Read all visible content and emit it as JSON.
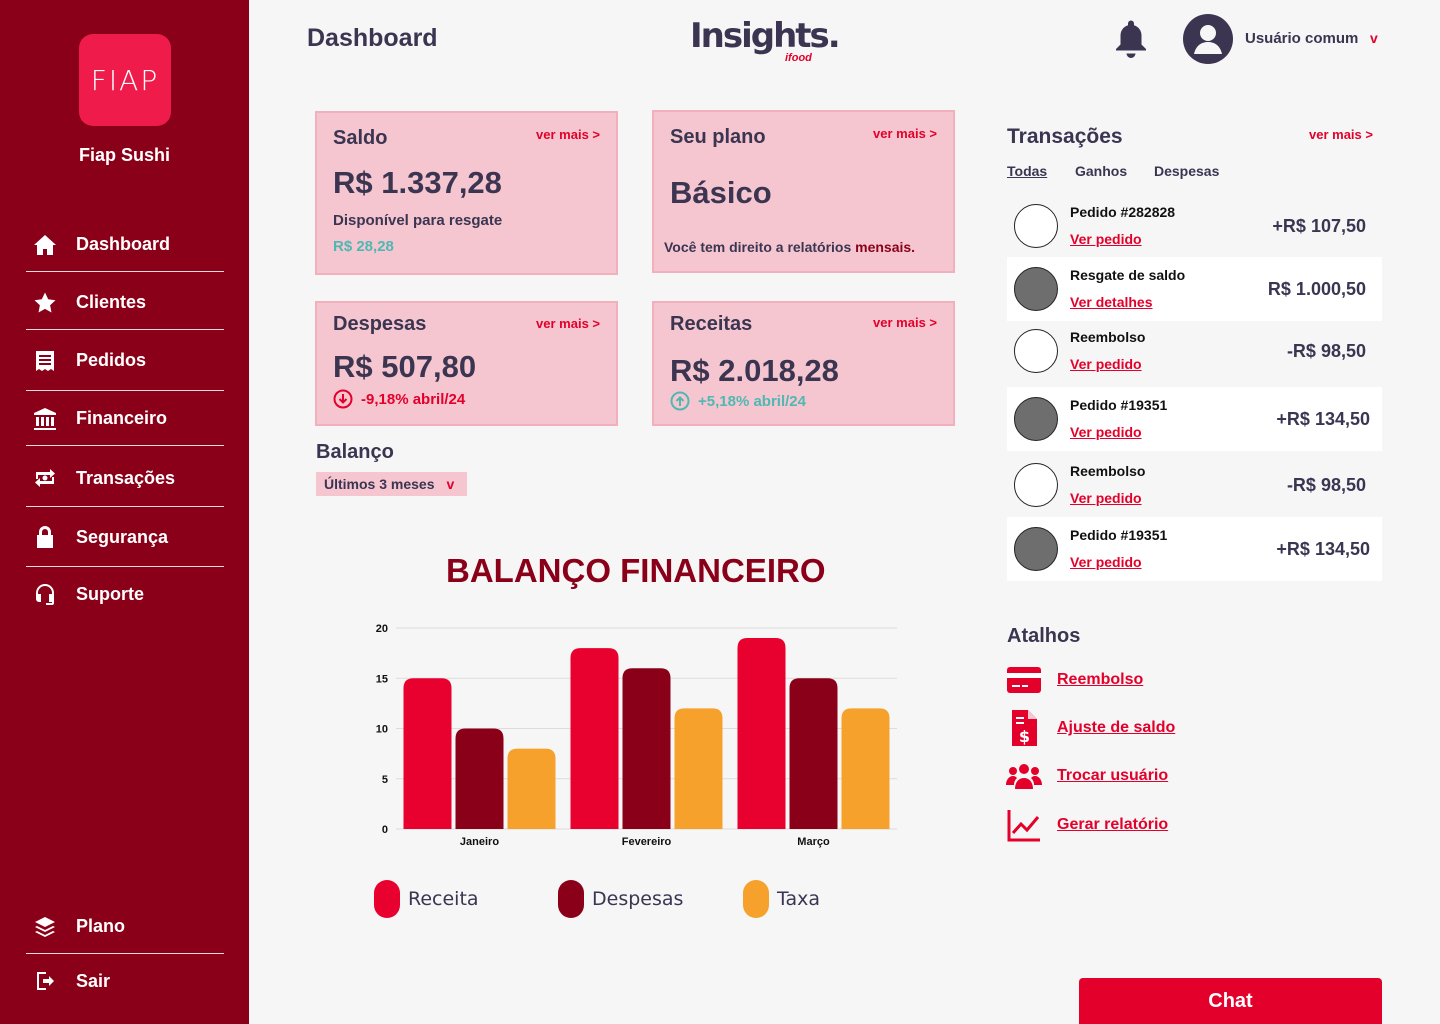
{
  "sidebar": {
    "logo_text": "FIAP",
    "brand": "Fiap Sushi",
    "items": [
      {
        "label": "Dashboard",
        "icon": "home-icon"
      },
      {
        "label": "Clientes",
        "icon": "star-icon"
      },
      {
        "label": "Pedidos",
        "icon": "receipt-icon"
      },
      {
        "label": "Financeiro",
        "icon": "bank-icon"
      },
      {
        "label": "Transações",
        "icon": "money-exchange-icon"
      },
      {
        "label": "Segurança",
        "icon": "lock-icon"
      },
      {
        "label": "Suporte",
        "icon": "headset-icon"
      }
    ],
    "bottom_items": [
      {
        "label": "Plano",
        "icon": "layers-icon"
      },
      {
        "label": "Sair",
        "icon": "logout-icon"
      }
    ]
  },
  "header": {
    "title": "Dashboard",
    "brand_logo": "Insights.",
    "brand_logo_sub": "ifood",
    "user_name": "Usuário comum",
    "user_chevron": "v"
  },
  "cards": {
    "ver_mais": "ver mais  >",
    "saldo": {
      "title": "Saldo",
      "value": "R$ 1.337,28",
      "sub": "Disponível para resgate",
      "sub_value": "R$ 28,28"
    },
    "plano": {
      "title": "Seu plano",
      "value": "Básico",
      "note_prefix": "Você tem direito a relatórios ",
      "note_highlight": "mensais."
    },
    "despesas": {
      "title": "Despesas",
      "value": "R$ 507,80",
      "trend": "-9,18% abril/24"
    },
    "receitas": {
      "title": "Receitas",
      "value": "R$ 2.018,28",
      "trend": "+5,18% abril/24"
    }
  },
  "balanco": {
    "title": "Balanço",
    "period": "Últimos 3 meses",
    "period_chevron": "v"
  },
  "chart_data": {
    "type": "bar",
    "title": "BALANÇO FINANCEIRO",
    "categories": [
      "Janeiro",
      "Fevereiro",
      "Março"
    ],
    "series": [
      {
        "name": "Receita",
        "values": [
          15,
          18,
          19
        ],
        "color": "#e8002f"
      },
      {
        "name": "Despesas",
        "values": [
          10,
          16,
          15
        ],
        "color": "#8a0019"
      },
      {
        "name": "Taxa",
        "values": [
          8,
          12,
          12
        ],
        "color": "#f5a12b"
      }
    ],
    "yticks": [
      0,
      5,
      10,
      15,
      20
    ],
    "ylim": [
      0,
      20
    ],
    "grid": true,
    "legend": "bottom"
  },
  "transactions": {
    "title": "Transações",
    "ver_mais": "ver mais  >",
    "tabs": [
      "Todas",
      "Ganhos",
      "Despesas"
    ],
    "rows": [
      {
        "name": "Pedido #282828",
        "link": "Ver pedido",
        "amount": "+R$ 107,50",
        "filled": false,
        "white": false
      },
      {
        "name": "Resgate de saldo",
        "link": "Ver detalhes",
        "amount": "R$ 1.000,50",
        "filled": true,
        "white": true
      },
      {
        "name": "Reembolso",
        "link": "Ver pedido",
        "amount": "-R$ 98,50",
        "filled": false,
        "white": false
      },
      {
        "name": "Pedido #19351",
        "link": "Ver pedido",
        "amount": "+R$ 134,50",
        "filled": true,
        "white": true
      },
      {
        "name": "Reembolso",
        "link": "Ver pedido",
        "amount": "-R$ 98,50",
        "filled": false,
        "white": false
      },
      {
        "name": "Pedido #19351",
        "link": "Ver pedido",
        "amount": "+R$ 134,50",
        "filled": true,
        "white": true
      }
    ]
  },
  "shortcuts": {
    "title": "Atalhos",
    "items": [
      {
        "label": "Reembolso",
        "icon": "credit-card-icon"
      },
      {
        "label": "Ajuste de saldo",
        "icon": "invoice-dollar-icon"
      },
      {
        "label": "Trocar usuário",
        "icon": "users-icon"
      },
      {
        "label": "Gerar relatório",
        "icon": "line-chart-icon"
      }
    ]
  },
  "chat": {
    "label": "Chat"
  },
  "colors": {
    "sidebar": "#8a0019",
    "accent": "#e3002b",
    "card": "#f5c6cf",
    "text": "#3b3552",
    "teal": "#4fb8b3"
  }
}
